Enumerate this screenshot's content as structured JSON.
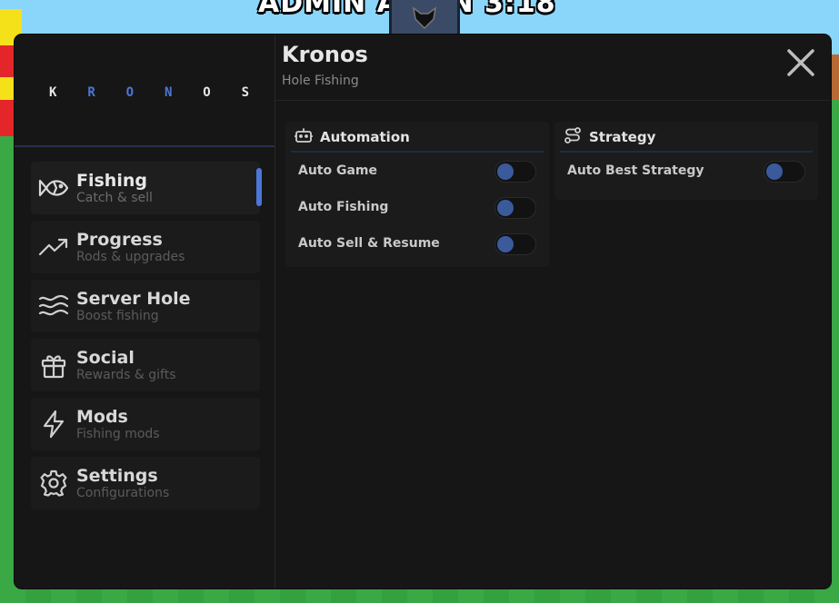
{
  "game": {
    "banner": "ADMIN A    E IN 3:18"
  },
  "brand": {
    "letters": [
      "K",
      "R",
      "O",
      "N",
      "O",
      "S"
    ]
  },
  "header": {
    "title": "Kronos",
    "subtitle": "Hole Fishing"
  },
  "sidebar": {
    "items": [
      {
        "title": "Fishing",
        "subtitle": "Catch & sell",
        "icon": "fish-icon",
        "active": true
      },
      {
        "title": "Progress",
        "subtitle": "Rods & upgrades",
        "icon": "trending-up-icon",
        "active": false
      },
      {
        "title": "Server Hole",
        "subtitle": "Boost fishing",
        "icon": "waves-icon",
        "active": false
      },
      {
        "title": "Social",
        "subtitle": "Rewards & gifts",
        "icon": "gift-icon",
        "active": false
      },
      {
        "title": "Mods",
        "subtitle": "Fishing mods",
        "icon": "lightning-icon",
        "active": false
      },
      {
        "title": "Settings",
        "subtitle": "Configurations",
        "icon": "gear-icon",
        "active": false
      }
    ]
  },
  "panels": {
    "automation": {
      "title": "Automation",
      "icon": "robot-icon",
      "rows": [
        {
          "label": "Auto Game",
          "enabled": false
        },
        {
          "label": "Auto Fishing",
          "enabled": false
        },
        {
          "label": "Auto Sell & Resume",
          "enabled": false
        }
      ]
    },
    "strategy": {
      "title": "Strategy",
      "icon": "route-icon",
      "rows": [
        {
          "label": "Auto Best Strategy",
          "enabled": false
        }
      ]
    }
  },
  "colors": {
    "accent": "#4c77d8",
    "window_bg": "#161616",
    "panel_bg": "#1b1b1b"
  }
}
